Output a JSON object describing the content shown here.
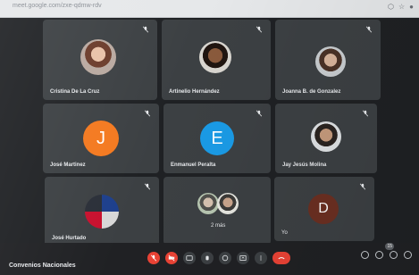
{
  "browser": {
    "url": "meet.google.com/zxe-qdmw-rdv"
  },
  "participants": [
    {
      "name": "Cristina De La Cruz",
      "type": "photo",
      "mic_muted": true
    },
    {
      "name": "Artinelio Hernández",
      "type": "photo",
      "mic_muted": true
    },
    {
      "name": "Joanna B. de Gonzalez",
      "type": "photo",
      "mic_muted": true
    },
    {
      "name": "José Martinez",
      "type": "letter",
      "letter": "J",
      "color": "#f4791f",
      "mic_muted": true
    },
    {
      "name": "Enmanuel Peralta",
      "type": "letter",
      "letter": "E",
      "color": "#1a9be6",
      "mic_muted": true
    },
    {
      "name": "Jay Jesús Molina",
      "type": "photo",
      "mic_muted": true
    },
    {
      "name": "José Hurtado",
      "type": "photo",
      "mic_muted": true
    },
    {
      "name": "2 más",
      "type": "group",
      "mic_muted": false
    },
    {
      "name": "Yo",
      "type": "letter",
      "letter": "D",
      "color": "#6b2f22",
      "mic_muted": true
    }
  ],
  "meeting": {
    "title": "Convenios Nacionales",
    "participant_count": "15"
  },
  "controls": [
    "mic-off",
    "camera-off",
    "captions",
    "raise-hand",
    "present",
    "more",
    "end-call"
  ]
}
